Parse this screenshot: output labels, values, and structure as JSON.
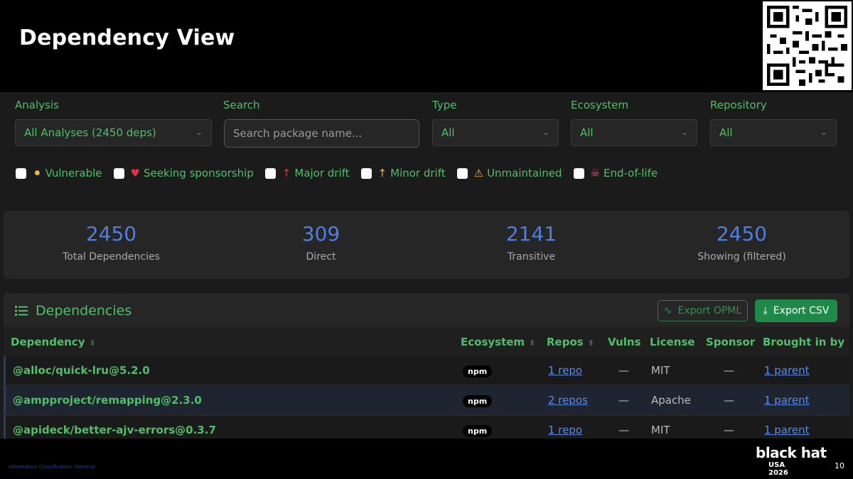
{
  "slide": {
    "title": "Dependency View",
    "classification": "Information Classification: General",
    "page_number": "10",
    "brand_line1": "black hat",
    "brand_line2": "USA",
    "brand_line3": "2026"
  },
  "filters": {
    "analysis_label": "Analysis",
    "analysis_value": "All Analyses (2450 deps)",
    "search_label": "Search",
    "search_placeholder": "Search package name...",
    "type_label": "Type",
    "type_value": "All",
    "ecosystem_label": "Ecosystem",
    "ecosystem_value": "All",
    "repository_label": "Repository",
    "repository_value": "All"
  },
  "checkboxes": [
    {
      "icon": "shield-icon",
      "label": "Vulnerable",
      "color": "#f2b632"
    },
    {
      "icon": "heart-icon",
      "label": "Seeking sponsorship",
      "color": "#e0333d"
    },
    {
      "icon": "arrow-up-icon",
      "label": "Major drift",
      "color": "#e0333d"
    },
    {
      "icon": "arrow-up-icon",
      "label": "Minor drift",
      "color": "#f2b632"
    },
    {
      "icon": "warning-icon",
      "label": "Unmaintained",
      "color": "#f2b632"
    },
    {
      "icon": "skull-crossbones-icon",
      "label": "End-of-life",
      "color": "#e0507a"
    }
  ],
  "stats": [
    {
      "value": "2450",
      "caption": "Total Dependencies"
    },
    {
      "value": "309",
      "caption": "Direct"
    },
    {
      "value": "2141",
      "caption": "Transitive"
    },
    {
      "value": "2450",
      "caption": "Showing (filtered)"
    }
  ],
  "panel": {
    "title": "Dependencies",
    "export_opml": "Export OPML",
    "export_csv": "Export CSV"
  },
  "table": {
    "columns": [
      "Dependency",
      "Ecosystem",
      "Repos",
      "Vulns",
      "License",
      "Sponsor",
      "Brought in by"
    ],
    "rows": [
      {
        "dependency": "@alloc/quick-lru@5.2.0",
        "ecosystem": "npm",
        "repos": "1 repo",
        "vulns": "—",
        "license": "MIT",
        "sponsor": "—",
        "brought_in_by": "1 parent"
      },
      {
        "dependency": "@ampproject/remapping@2.3.0",
        "ecosystem": "npm",
        "repos": "2 repos",
        "vulns": "—",
        "license": "Apache",
        "sponsor": "—",
        "brought_in_by": "1 parent"
      },
      {
        "dependency": "@apideck/better-ajv-errors@0.3.7",
        "ecosystem": "npm",
        "repos": "1 repo",
        "vulns": "—",
        "license": "MIT",
        "sponsor": "—",
        "brought_in_by": "1 parent"
      }
    ]
  },
  "colors": {
    "accent_green": "#4fbf6a",
    "stat_blue": "#4f7fe0",
    "link_blue": "#5b8ae6",
    "button_green": "#1e8a48"
  }
}
